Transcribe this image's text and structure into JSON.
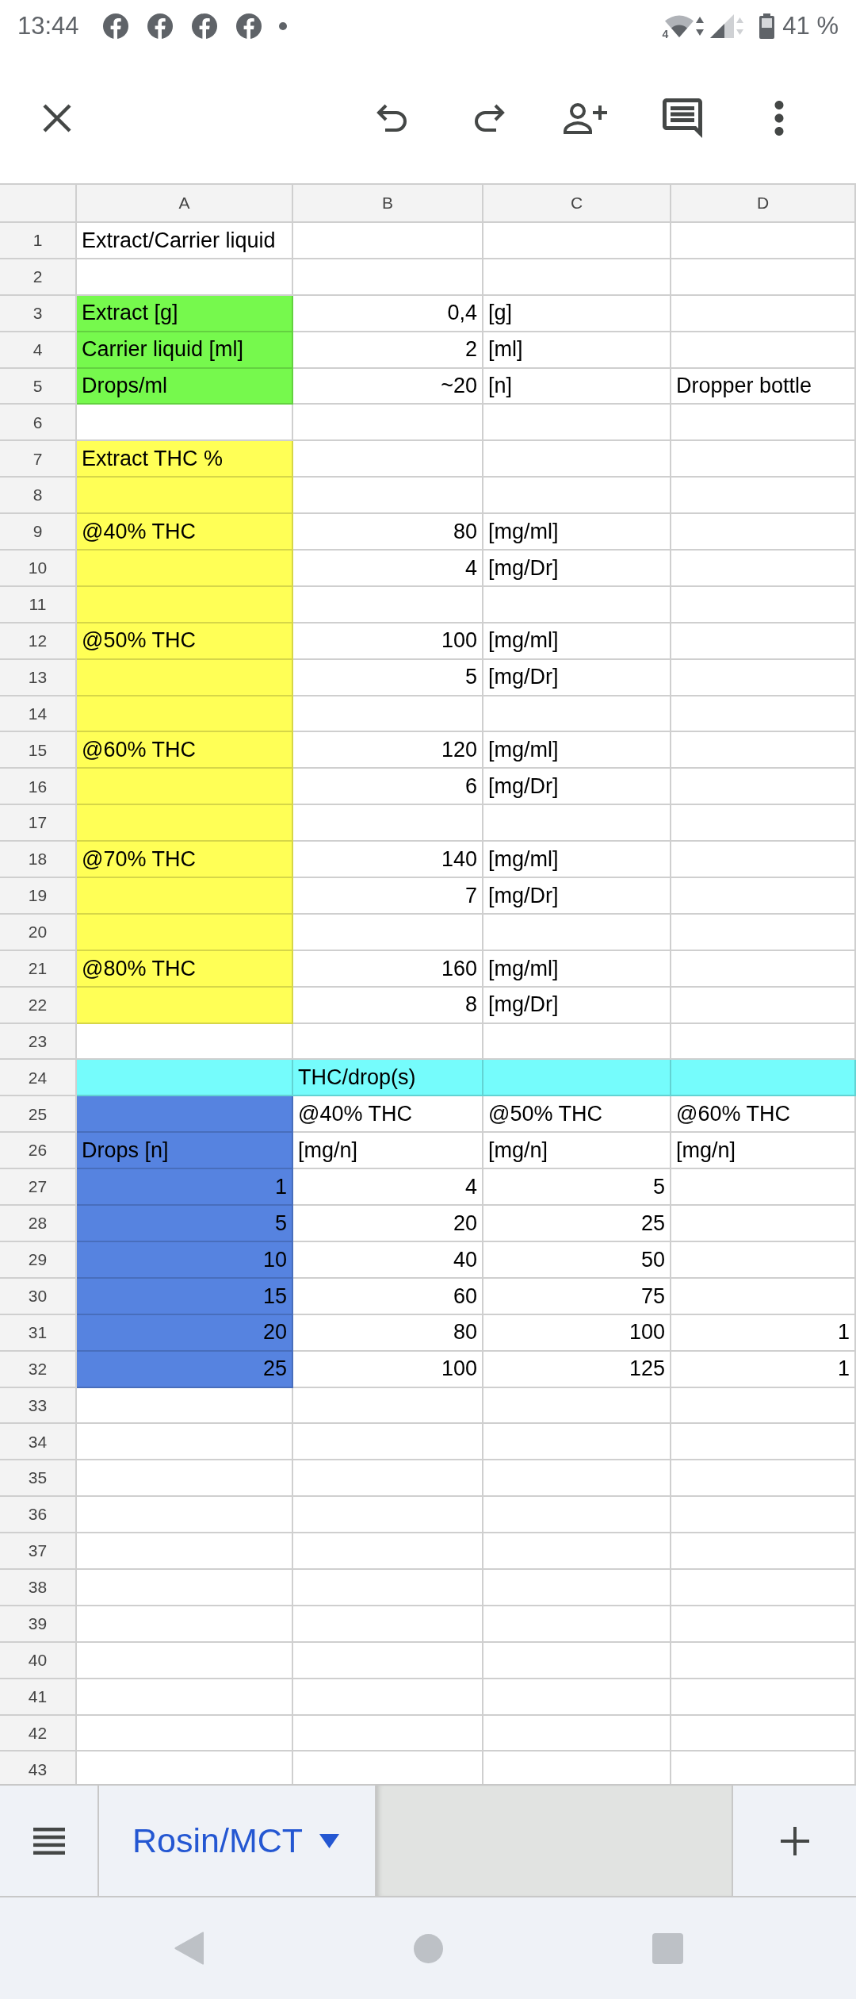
{
  "status_bar": {
    "time": "13:44",
    "wifi_label": "4",
    "battery": "41 %"
  },
  "sheet": {
    "columns": [
      "A",
      "B",
      "C",
      "D"
    ],
    "rows": [
      {
        "number": "1",
        "cells": [
          {
            "text": "Extract/Carrier liquid"
          }
        ]
      },
      {
        "number": "2"
      },
      {
        "number": "3",
        "cells": [
          {
            "text": "Extract [g]",
            "color": "#76f94d"
          },
          {
            "text": "0,4",
            "kind": "number"
          },
          {
            "text": "[g]"
          }
        ]
      },
      {
        "number": "4",
        "cells": [
          {
            "text": "Carrier liquid [ml]",
            "color": "#76f94d"
          },
          {
            "text": "2",
            "kind": "number"
          },
          {
            "text": "[ml]"
          }
        ]
      },
      {
        "number": "5",
        "cells": [
          {
            "text": "Drops/ml",
            "color": "#76f94d"
          },
          {
            "text": "~20",
            "kind": "number"
          },
          {
            "text": "[n]"
          },
          {
            "text": "Dropper bottle"
          }
        ]
      },
      {
        "number": "6"
      },
      {
        "number": "7",
        "cells": [
          {
            "text": "Extract THC %",
            "color": "#ffff56"
          }
        ]
      },
      {
        "number": "8",
        "cells": [
          {
            "color": "#ffff56"
          }
        ]
      },
      {
        "number": "9",
        "cells": [
          {
            "text": "@40% THC",
            "color": "#ffff56"
          },
          {
            "text": "80",
            "kind": "number"
          },
          {
            "text": "[mg/ml]"
          }
        ]
      },
      {
        "number": "10",
        "cells": [
          {
            "color": "#ffff56"
          },
          {
            "text": "4",
            "kind": "number"
          },
          {
            "text": "[mg/Dr]"
          }
        ]
      },
      {
        "number": "11",
        "cells": [
          {
            "color": "#ffff56"
          }
        ]
      },
      {
        "number": "12",
        "cells": [
          {
            "text": "@50% THC",
            "color": "#ffff56"
          },
          {
            "text": "100",
            "kind": "number"
          },
          {
            "text": "[mg/ml]"
          }
        ]
      },
      {
        "number": "13",
        "cells": [
          {
            "color": "#ffff56"
          },
          {
            "text": "5",
            "kind": "number"
          },
          {
            "text": "[mg/Dr]"
          }
        ]
      },
      {
        "number": "14",
        "cells": [
          {
            "color": "#ffff56"
          }
        ]
      },
      {
        "number": "15",
        "cells": [
          {
            "text": "@60% THC",
            "color": "#ffff56"
          },
          {
            "text": "120",
            "kind": "number"
          },
          {
            "text": "[mg/ml]"
          }
        ]
      },
      {
        "number": "16",
        "cells": [
          {
            "color": "#ffff56"
          },
          {
            "text": "6",
            "kind": "number"
          },
          {
            "text": "[mg/Dr]"
          }
        ]
      },
      {
        "number": "17",
        "cells": [
          {
            "color": "#ffff56"
          }
        ]
      },
      {
        "number": "18",
        "cells": [
          {
            "text": "@70% THC",
            "color": "#ffff56"
          },
          {
            "text": "140",
            "kind": "number"
          },
          {
            "text": "[mg/ml]"
          }
        ]
      },
      {
        "number": "19",
        "cells": [
          {
            "color": "#ffff56"
          },
          {
            "text": "7",
            "kind": "number"
          },
          {
            "text": "[mg/Dr]"
          }
        ]
      },
      {
        "number": "20",
        "cells": [
          {
            "color": "#ffff56"
          }
        ]
      },
      {
        "number": "21",
        "cells": [
          {
            "text": "@80% THC",
            "color": "#ffff56"
          },
          {
            "text": "160",
            "kind": "number"
          },
          {
            "text": "[mg/ml]"
          }
        ]
      },
      {
        "number": "22",
        "cells": [
          {
            "color": "#ffff56"
          },
          {
            "text": "8",
            "kind": "number"
          },
          {
            "text": "[mg/Dr]"
          }
        ]
      },
      {
        "number": "23"
      },
      {
        "number": "24",
        "cells": [
          {
            "color": "#75fcfc"
          },
          {
            "text": "THC/drop(s)",
            "color": "#75fcfc"
          },
          {
            "color": "#75fcfc"
          },
          {
            "color": "#75fcfc"
          }
        ]
      },
      {
        "number": "25",
        "cells": [
          {
            "color": "#5683e0"
          },
          {
            "text": "@40% THC"
          },
          {
            "text": "@50% THC"
          },
          {
            "text": "@60% THC"
          }
        ]
      },
      {
        "number": "26",
        "cells": [
          {
            "text": "Drops [n]",
            "color": "#5683e0"
          },
          {
            "text": "[mg/n]"
          },
          {
            "text": "[mg/n]"
          },
          {
            "text": "[mg/n]"
          }
        ]
      },
      {
        "number": "27",
        "cells": [
          {
            "text": "1",
            "color": "#5683e0",
            "kind": "number"
          },
          {
            "text": "4",
            "kind": "number"
          },
          {
            "text": "5",
            "kind": "number"
          }
        ]
      },
      {
        "number": "28",
        "cells": [
          {
            "text": "5",
            "color": "#5683e0",
            "kind": "number"
          },
          {
            "text": "20",
            "kind": "number"
          },
          {
            "text": "25",
            "kind": "number"
          }
        ]
      },
      {
        "number": "29",
        "cells": [
          {
            "text": "10",
            "color": "#5683e0",
            "kind": "number"
          },
          {
            "text": "40",
            "kind": "number"
          },
          {
            "text": "50",
            "kind": "number"
          }
        ]
      },
      {
        "number": "30",
        "cells": [
          {
            "text": "15",
            "color": "#5683e0",
            "kind": "number"
          },
          {
            "text": "60",
            "kind": "number"
          },
          {
            "text": "75",
            "kind": "number"
          }
        ]
      },
      {
        "number": "31",
        "cells": [
          {
            "text": "20",
            "color": "#5683e0",
            "kind": "number"
          },
          {
            "text": "80",
            "kind": "number"
          },
          {
            "text": "100",
            "kind": "number"
          },
          {
            "text": "1",
            "kind": "number"
          }
        ]
      },
      {
        "number": "32",
        "cells": [
          {
            "text": "25",
            "color": "#5683e0",
            "kind": "number"
          },
          {
            "text": "100",
            "kind": "number"
          },
          {
            "text": "125",
            "kind": "number"
          },
          {
            "text": "1",
            "kind": "number"
          }
        ]
      },
      {
        "number": "33"
      },
      {
        "number": "34"
      },
      {
        "number": "35"
      },
      {
        "number": "36"
      },
      {
        "number": "37"
      },
      {
        "number": "38"
      },
      {
        "number": "39"
      },
      {
        "number": "40"
      },
      {
        "number": "41"
      },
      {
        "number": "42"
      },
      {
        "number": "43"
      }
    ]
  },
  "sheet_tabs": [
    {
      "label": "Rosin/MCT",
      "selected": true
    }
  ]
}
